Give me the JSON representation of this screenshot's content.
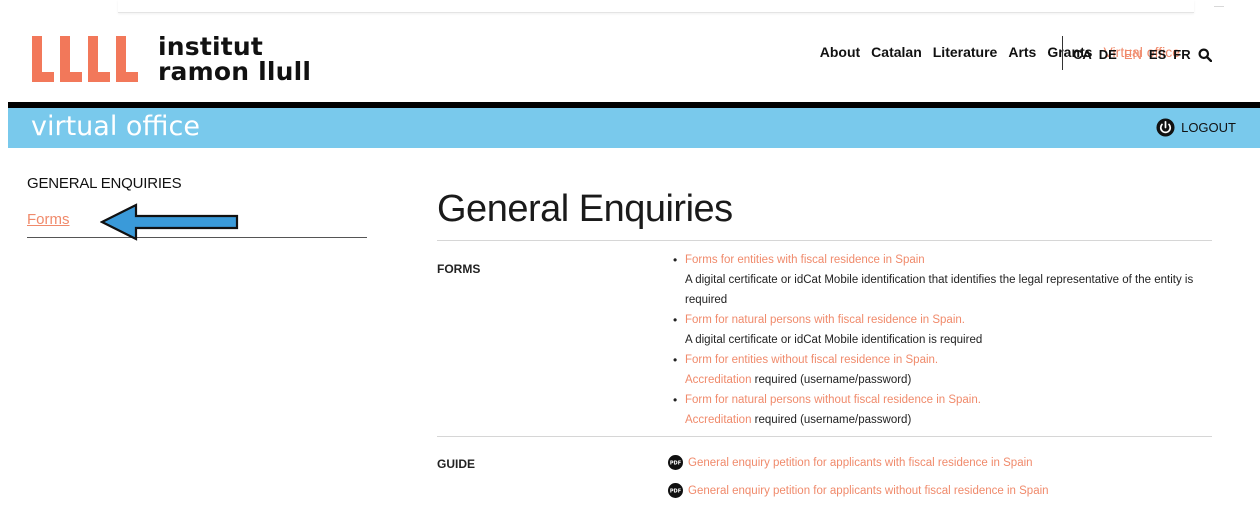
{
  "brand": {
    "line1": "institut",
    "line2": "ramon llull",
    "accent": "#f08a6b"
  },
  "nav": {
    "items": [
      "About",
      "Catalan",
      "Literature",
      "Arts",
      "Grants",
      "Virtual office"
    ],
    "active_index": 5
  },
  "languages": {
    "items": [
      "CA",
      "DE",
      "EN",
      "ES",
      "FR"
    ],
    "active_index": 2,
    "search_icon": "search-icon"
  },
  "banner": {
    "title": "virtual office",
    "logout": "LOGOUT",
    "color": "#79c9ec"
  },
  "sidebar": {
    "title": "GENERAL ENQUIRIES",
    "link": "Forms"
  },
  "main": {
    "title": "General Enquiries",
    "forms_label": "FORMS",
    "forms": [
      {
        "link": "Forms for entities with fiscal residence in Spain",
        "text": "A digital certificate or idCat Mobile identification that identifies the legal representative of the entity is required"
      },
      {
        "link": "Form for natural persons with fiscal residence in Spain",
        "text": "A digital certificate or idCat Mobile identification is required"
      },
      {
        "link": "Form for entities without fiscal residence in Spain",
        "sublink": "Accreditation",
        "text": " required (username/password)"
      },
      {
        "link": "Form for natural persons without fiscal residence in Spain",
        "sublink": "Accreditation",
        "text": " required (username/password)"
      }
    ],
    "guide_label": "GUIDE",
    "guides": [
      "General enquiry petition for applicants with fiscal residence in Spain",
      "General enquiry petition for applicants without fiscal residence in Spain"
    ]
  }
}
